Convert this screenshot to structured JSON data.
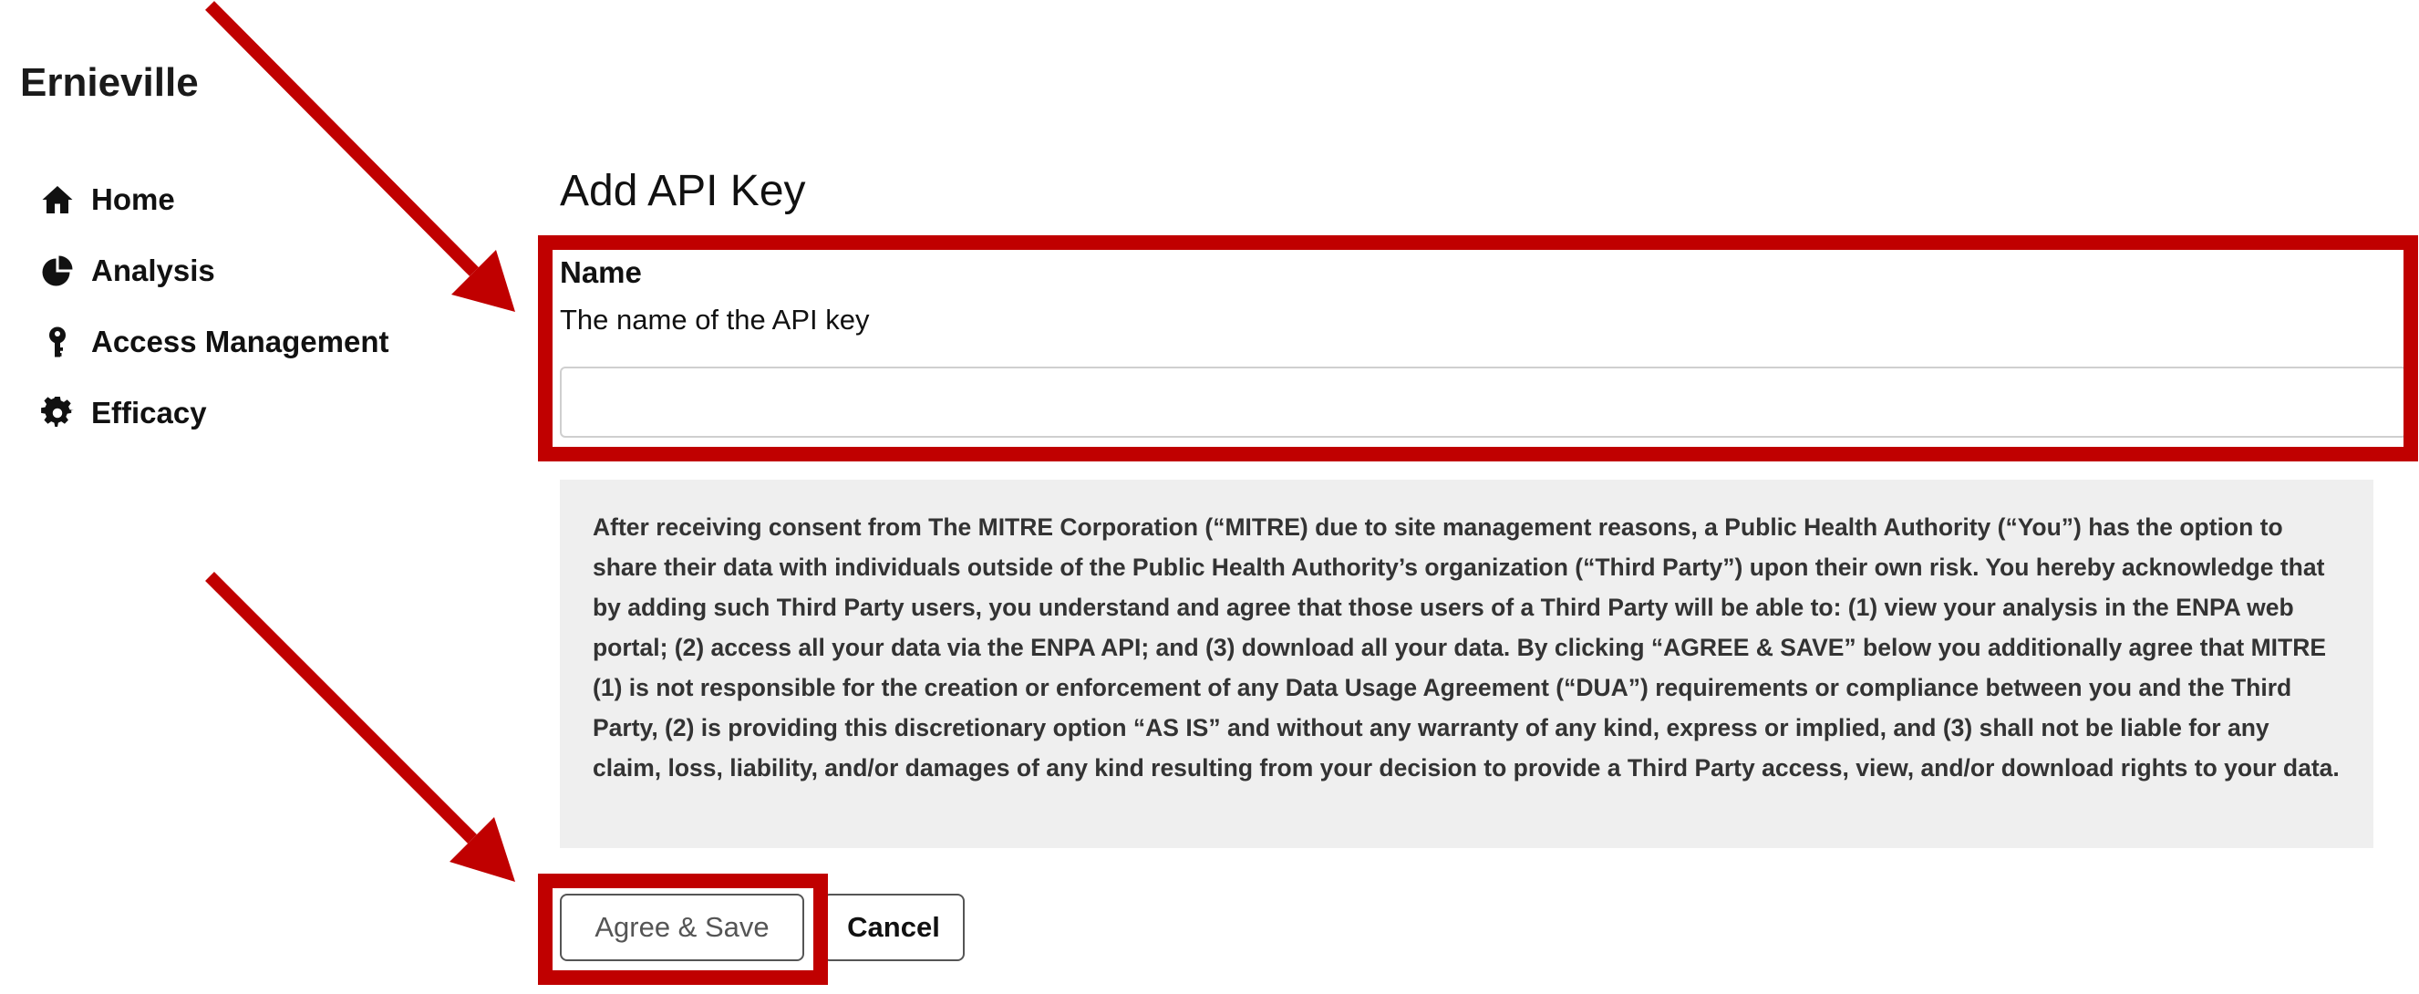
{
  "app": {
    "org_name": "Ernieville"
  },
  "sidebar": {
    "items": [
      {
        "label": "Home",
        "icon": "home-icon"
      },
      {
        "label": "Analysis",
        "icon": "pie-chart-icon"
      },
      {
        "label": "Access Management",
        "icon": "key-icon"
      },
      {
        "label": "Efficacy",
        "icon": "gear-icon"
      }
    ]
  },
  "main": {
    "title": "Add API Key",
    "name_field": {
      "label": "Name",
      "help": "The name of the API key",
      "value": ""
    },
    "consent_text": "After receiving consent from The MITRE Corporation (“MITRE) due to site management reasons, a Public Health Authority (“You”) has the option to share their data with individuals outside of the Public Health Authority’s organization (“Third Party”) upon their own risk. You hereby acknowledge that by adding such Third Party users, you understand and agree that those users of a Third Party will be able to: (1) view your analysis in the ENPA web portal; (2) access all your data via the ENPA API; and (3) download all your data. By clicking “AGREE & SAVE” below you additionally agree that MITRE (1) is not responsible for the creation or enforcement of any Data Usage Agreement (“DUA”) requirements or compliance between you and the Third Party, (2) is providing this discretionary option “AS IS” and without any warranty of any kind, express or implied, and (3) shall not be liable for any claim, loss, liability, and/or damages of any kind resulting from your decision to provide a Third Party access, view, and/or download rights to your data.",
    "buttons": {
      "save": "Agree & Save",
      "cancel": "Cancel"
    }
  },
  "annotations": {
    "highlight_color": "#c00000"
  }
}
